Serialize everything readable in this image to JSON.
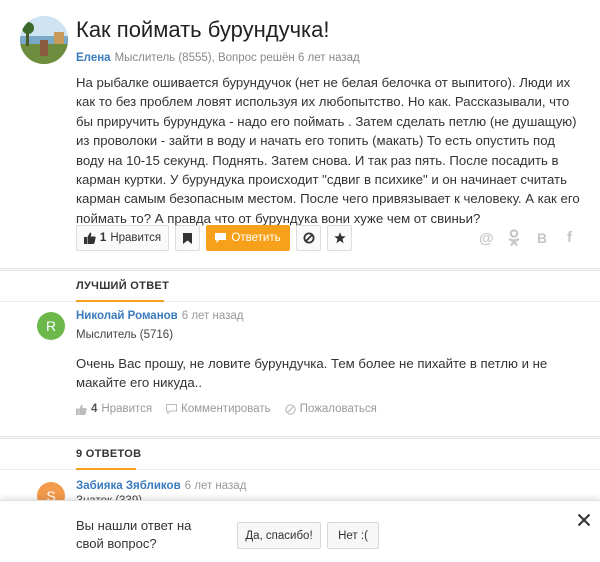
{
  "question": {
    "title": "Как поймать бурундучка!",
    "author": "Елена",
    "meta": "Мыслитель (8555), Вопрос решён 6 лет назад",
    "text": "На рыбалке ошивается бурундучок (нет не белая белочка от выпитого). Люди их как то без проблем ловят используя их любопытство. Но как. Рассказывали, что бы приручить бурундука - надо его поймать . Затем сделать петлю (не душащую) из проволоки - зайти в воду и начать его топить (макать) То есть опустить под воду на 10-15 секунд. Поднять. Затем снова. И так раз пять. После посадить в карман куртки. У бурундука происходит \"сдвиг в психике\" и он начинает считать карман самым безопасным местом. После чего привязывает к человеку. А как его поймать то? А правда что от бурундука вони хуже чем от свиньи?",
    "like_count": "1",
    "like_label": "Нравится",
    "answer_label": "Ответить",
    "share_icons": [
      "at-icon",
      "odnoklassniki-icon",
      "vk-icon",
      "facebook-icon"
    ],
    "share_glyphs": [
      "@",
      "ok",
      "В",
      "f"
    ]
  },
  "best_answer": {
    "heading": "ЛУЧШИЙ ОТВЕТ",
    "avatar_letter": "R",
    "avatar_color": "#6cb84a",
    "name": "Николай Романов",
    "time": "6 лет назад",
    "rank": "Мыслитель (5716)",
    "text": "Очень Вас прошу, не ловите бурундучка. Тем более не пихайте в петлю и не макайте его никуда..",
    "like_count": "4",
    "like_label": "Нравится",
    "comment_label": "Комментировать",
    "report_label": "Пожаловаться"
  },
  "answers": {
    "heading": "9 ОТВЕТОВ",
    "first": {
      "avatar_letter": "S",
      "avatar_color": "#f39a4c",
      "name": "Забияка Зябликов",
      "time": "6 лет назад",
      "rank": "Знаток (339)"
    }
  },
  "feedback": {
    "question": "Вы нашли ответ на свой вопрос?",
    "yes_label": "Да, спасибо!",
    "no_label": "Нет :("
  },
  "colors": {
    "accent": "#f7a11a",
    "link": "#3a7bbf"
  }
}
